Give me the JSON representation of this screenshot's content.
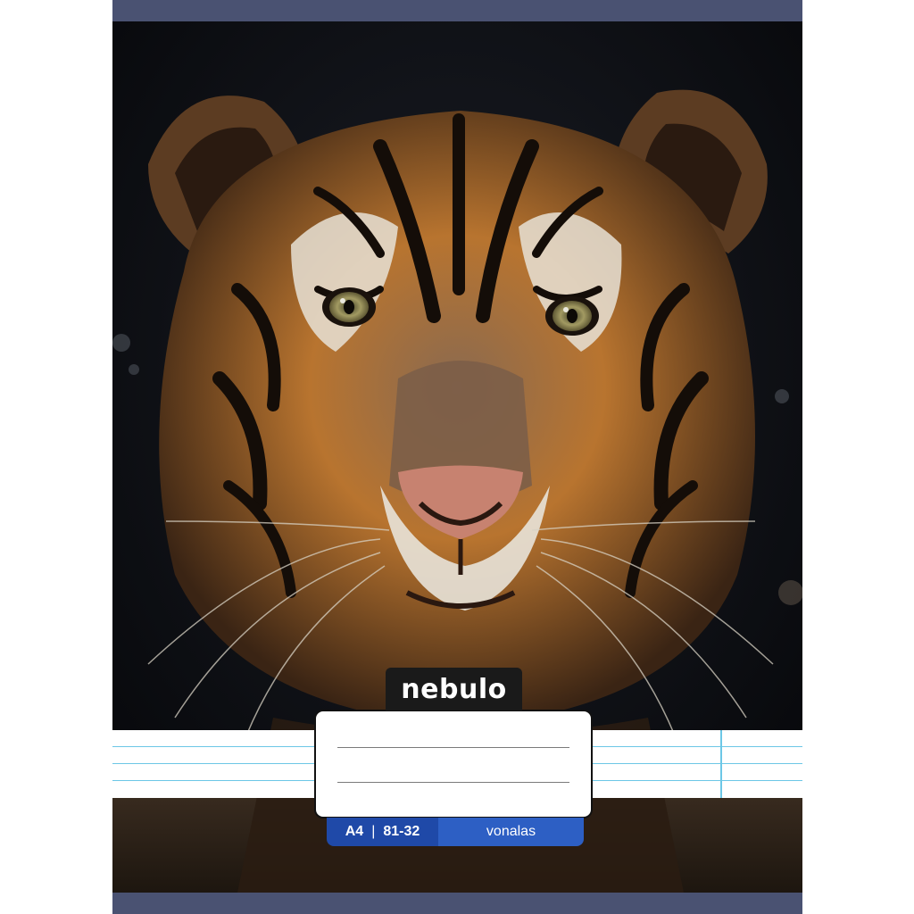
{
  "notebook": {
    "brand": "nebulo",
    "format": "A4",
    "separator": "|",
    "code": "81-32",
    "ruling": "vonalas"
  },
  "colors": {
    "band": "#4a5272",
    "spec_left": "#1f49a8",
    "spec_right": "#2d5fc4",
    "rule_line": "#6cc7e6",
    "fur_orange": "#c8782e",
    "fur_dark": "#1a120c",
    "nose": "#c78270"
  },
  "cover_image": {
    "subject": "tiger-face-icon"
  }
}
